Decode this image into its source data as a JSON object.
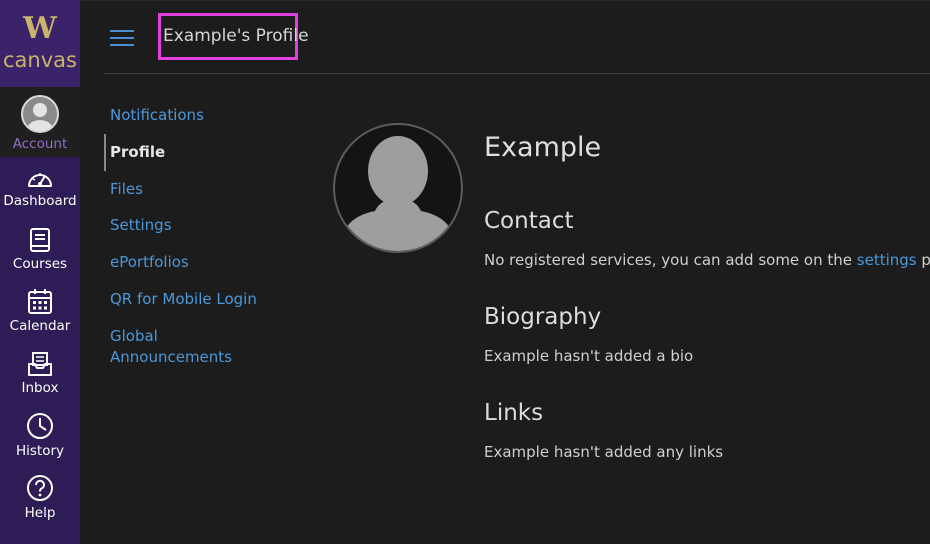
{
  "brand": {
    "logo_mark": "W",
    "logo_text": "canvas",
    "accent_color": "#2d1c55",
    "logo_color": "#c9b46a"
  },
  "global_nav": {
    "items": [
      {
        "label": "Account",
        "icon": "avatar-icon"
      },
      {
        "label": "Dashboard",
        "icon": "dashboard-icon"
      },
      {
        "label": "Courses",
        "icon": "courses-icon"
      },
      {
        "label": "Calendar",
        "icon": "calendar-icon"
      },
      {
        "label": "Inbox",
        "icon": "inbox-icon"
      },
      {
        "label": "History",
        "icon": "history-icon"
      },
      {
        "label": "Help",
        "icon": "help-icon"
      }
    ]
  },
  "header": {
    "menu_icon": "hamburger-icon",
    "title": "Example's Profile",
    "highlight_color": "#e040e0"
  },
  "section_menu": {
    "items": [
      {
        "label": "Notifications",
        "active": false
      },
      {
        "label": "Profile",
        "active": true
      },
      {
        "label": "Files",
        "active": false
      },
      {
        "label": "Settings",
        "active": false
      },
      {
        "label": "ePortfolios",
        "active": false
      },
      {
        "label": "QR for Mobile Login",
        "active": false
      },
      {
        "label": "Global Announcements",
        "active": false
      }
    ]
  },
  "profile": {
    "name": "Example",
    "contact": {
      "heading": "Contact",
      "text_before": "No registered services, you can add some on the ",
      "link_text": "settings",
      "text_after": " page."
    },
    "biography": {
      "heading": "Biography",
      "text": "Example hasn't added a bio"
    },
    "links": {
      "heading": "Links",
      "text": "Example hasn't added any links"
    }
  },
  "link_color": "#4a98da"
}
